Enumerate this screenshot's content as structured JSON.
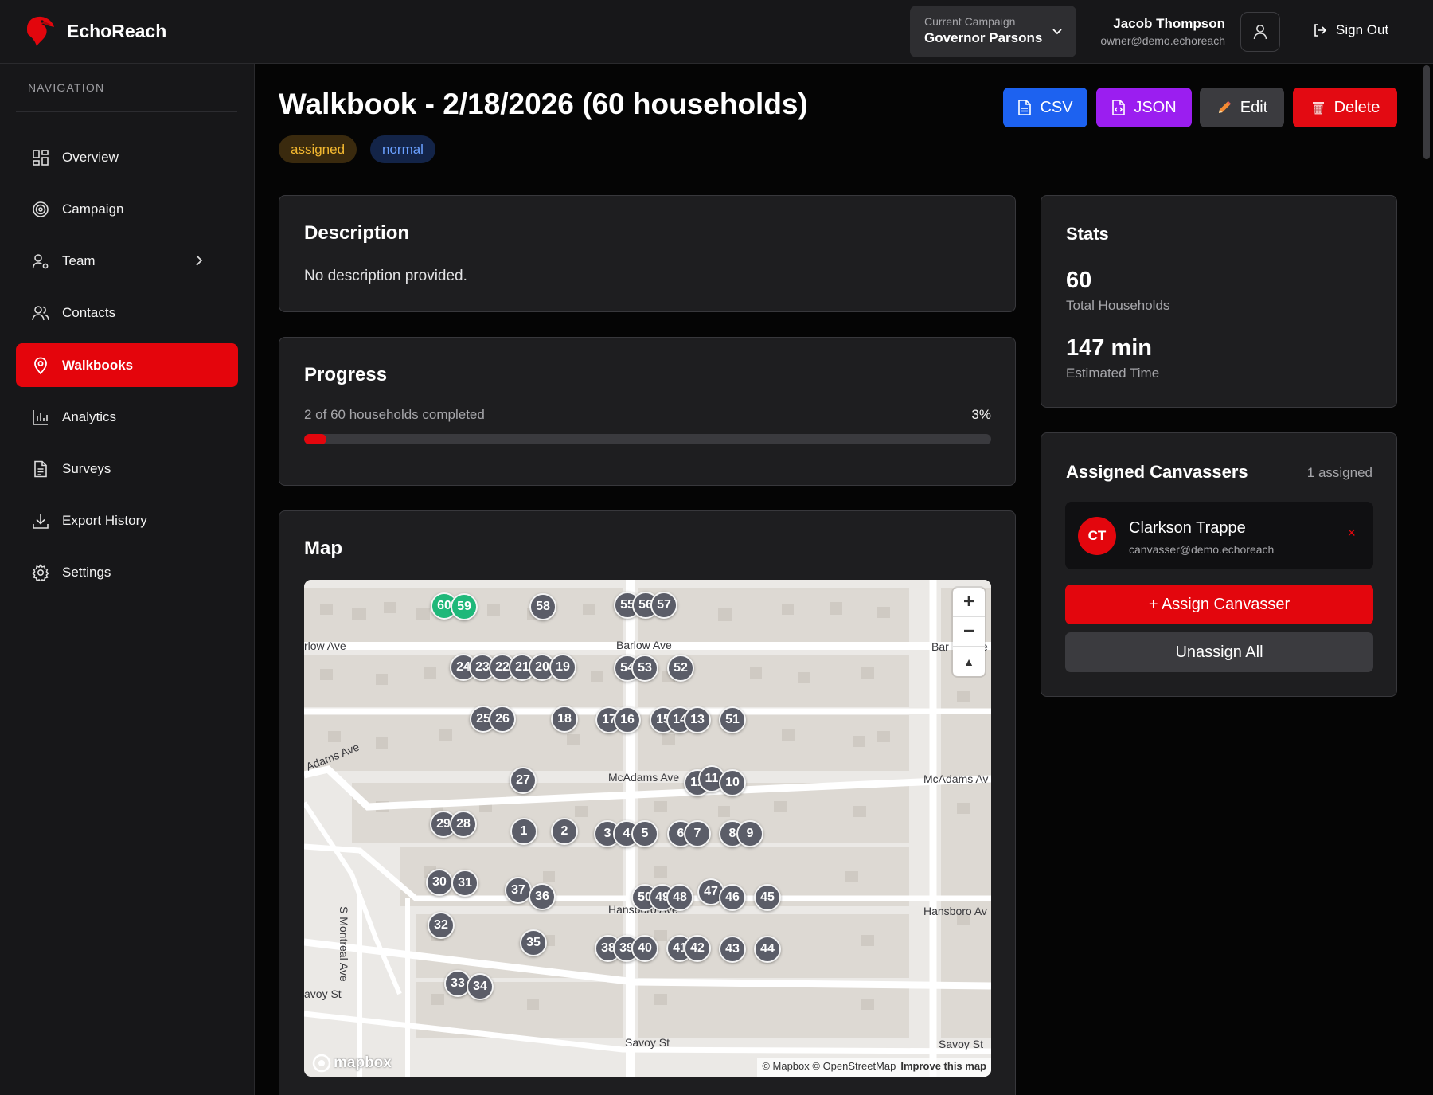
{
  "brand": {
    "name": "EchoReach",
    "accent": "#e3060d"
  },
  "header": {
    "campaign_label": "Current Campaign",
    "campaign_name": "Governor Parsons",
    "user_name": "Jacob Thompson",
    "user_email": "owner@demo.echoreach",
    "sign_out": "Sign Out"
  },
  "sidebar": {
    "heading": "NAVIGATION",
    "items": [
      {
        "label": "Overview",
        "icon": "grid-icon"
      },
      {
        "label": "Campaign",
        "icon": "target-icon"
      },
      {
        "label": "Team",
        "icon": "user-gear-icon"
      },
      {
        "label": "Contacts",
        "icon": "users-icon"
      },
      {
        "label": "Walkbooks",
        "icon": "map-pin-icon",
        "active": true
      },
      {
        "label": "Analytics",
        "icon": "bar-chart-icon"
      },
      {
        "label": "Surveys",
        "icon": "document-icon"
      },
      {
        "label": "Export History",
        "icon": "download-icon"
      },
      {
        "label": "Settings",
        "icon": "gear-icon"
      }
    ]
  },
  "page": {
    "title": "Walkbook - 2/18/2026 (60 households)",
    "status_badge": "assigned",
    "priority_badge": "normal",
    "actions": {
      "csv": "CSV",
      "json": "JSON",
      "edit": "Edit",
      "delete": "Delete"
    }
  },
  "description": {
    "title": "Description",
    "text": "No description provided."
  },
  "progress": {
    "title": "Progress",
    "label": "2 of 60 households completed",
    "percent_text": "3%",
    "fraction": 0.033
  },
  "map": {
    "title": "Map",
    "streets": [
      "rlow Ave",
      "Barlow Ave",
      "Bar",
      "ve",
      "Adams Ave",
      "McAdams Ave",
      "McAdams Av",
      "Hansboro Ave",
      "Hansboro Av",
      "S Montreal Ave",
      "avoy St",
      "Savoy St",
      "Savoy St"
    ],
    "markers": [
      "60",
      "59",
      "58",
      "55",
      "56",
      "57",
      "24",
      "23",
      "22",
      "21",
      "20",
      "19",
      "54",
      "53",
      "52",
      "25",
      "26",
      "18",
      "17",
      "16",
      "15",
      "14",
      "13",
      "51",
      "27",
      "12",
      "11",
      "10",
      "29",
      "28",
      "1",
      "2",
      "3",
      "4",
      "5",
      "6",
      "7",
      "8",
      "9",
      "30",
      "31",
      "37",
      "36",
      "50",
      "49",
      "48",
      "47",
      "46",
      "45",
      "32",
      "35",
      "38",
      "39",
      "40",
      "41",
      "42",
      "43",
      "44",
      "33",
      "34"
    ],
    "completed_markers": [
      "60",
      "59"
    ],
    "controls": {
      "zoom_in": "+",
      "zoom_out": "−",
      "compass": "▲"
    },
    "logo": "mapbox",
    "attribution": "© Mapbox © OpenStreetMap",
    "improve": "Improve this map"
  },
  "stats": {
    "title": "Stats",
    "households_value": "60",
    "households_label": "Total Households",
    "time_value": "147 min",
    "time_label": "Estimated Time"
  },
  "canvassers": {
    "title": "Assigned Canvassers",
    "count": "1 assigned",
    "list": [
      {
        "initials": "CT",
        "name": "Clarkson Trappe",
        "email": "canvasser@demo.echoreach",
        "remove": "×"
      }
    ],
    "assign_label": "+  Assign Canvasser",
    "unassign_label": "Unassign All"
  }
}
